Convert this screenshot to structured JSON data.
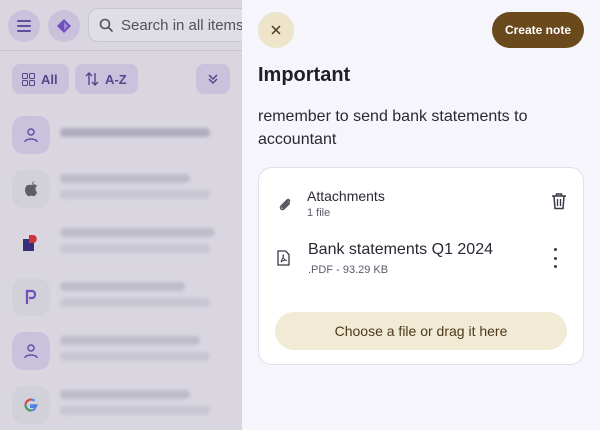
{
  "topbar": {
    "search_placeholder": "Search in all items"
  },
  "filters": {
    "all_label": "All",
    "sort_label": "A-Z"
  },
  "drawer": {
    "create_note_label": "Create note",
    "title": "Important",
    "body": "remember to send bank statements to accountant",
    "attachments": {
      "heading": "Attachments",
      "count": "1 file",
      "files": [
        {
          "name": "Bank statements Q1 2024",
          "meta": ".PDF - 93.29 KB"
        }
      ],
      "dropzone_label": "Choose a file or drag it here"
    }
  },
  "colors": {
    "accent": "#6a4a1c",
    "brand_purple": "#6d4ac7"
  }
}
